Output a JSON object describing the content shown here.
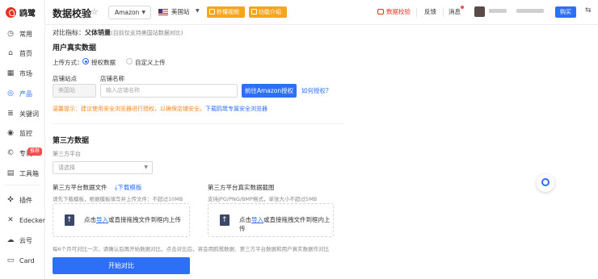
{
  "brand": {
    "name": "鸥鹭"
  },
  "sidebar": {
    "items": [
      {
        "label": "常用",
        "icon": "clock-icon"
      },
      {
        "label": "首页",
        "icon": "home-icon"
      },
      {
        "label": "市场",
        "icon": "market-icon"
      },
      {
        "label": "产品",
        "icon": "product-icon"
      },
      {
        "label": "关键词",
        "icon": "keyword-icon"
      },
      {
        "label": "监控",
        "icon": "monitor-icon"
      },
      {
        "label": "专利",
        "icon": "patent-icon",
        "badge": "推荐"
      },
      {
        "label": "工具箱",
        "icon": "toolbox-icon"
      },
      {
        "label": "插件",
        "icon": "plugin-icon"
      },
      {
        "label": "Edecker",
        "icon": "edecker-icon"
      },
      {
        "label": "云号",
        "icon": "cloud-icon"
      },
      {
        "label": "Card",
        "icon": "card-icon"
      }
    ],
    "active_index": 3
  },
  "header": {
    "title": "数据校验",
    "platform": "Amazon",
    "site": "美国站",
    "tag_video": "秒懂视频",
    "tag_intro": "功能介绍",
    "data_check": "数据校验",
    "feedback": "反馈",
    "messages": "消息",
    "buy": "购买"
  },
  "main": {
    "metric_prefix": "对比指标：",
    "metric_value": "父体销量",
    "metric_note": "(目前仅支持美国站数据对比)",
    "real_section": "用户真实数据",
    "upload_mode_label": "上传方式：",
    "radio_auth": "授权数据",
    "radio_custom": "自定义上传",
    "store_site_label": "店铺站点",
    "store_name_label": "店铺名称",
    "store_site_value": "美国站",
    "store_name_placeholder": "输入店铺名称",
    "auth_button": "前往Amazon授权",
    "how_auth": "如何授权?",
    "warning": "温馨提示：建议使用安全浏览器进行授权，以确保店铺安全。",
    "warning_link": "下载鸥鹭专属安全浏览器",
    "third_section": "第三方数据",
    "third_platform_label": "第三方平台",
    "third_platform_placeholder": "请选择",
    "upload_left_title": "第三方平台数据文件",
    "download_template": "下载模板",
    "upload_left_hint": "请先下载模板，根据模板填写并上传文件：不超过10MB",
    "upload_right_title": "第三方平台真实数据截图",
    "upload_right_hint": "支持JPG/PNG/BMP格式，单张大小不超过5MB",
    "upload_text_prefix": "点击",
    "upload_text_link": "导入",
    "upload_text_suffix": "或直接拖拽文件到框内上传",
    "footer_note": "每6个月可对比一次，请确认后再开始数据对比，点击对比后，将会用鸥鹭数据、第三方平台数据和用户真实数据作对比",
    "start_button": "开始对比"
  }
}
